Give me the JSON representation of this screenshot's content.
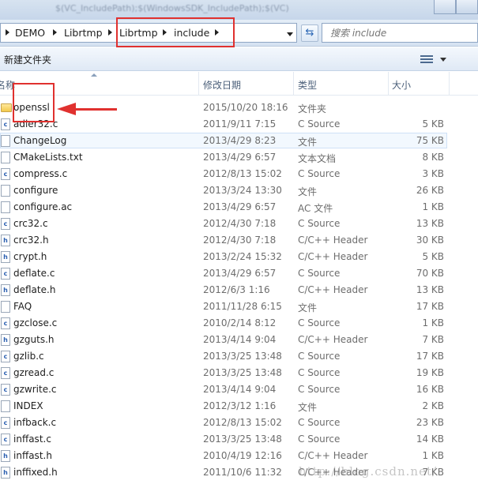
{
  "window_title_blur": "$(VC_IncludePath);$(WindowsSDK_IncludePath);$(VC)",
  "address": {
    "crumbs": [
      "DEMO",
      "Librtmp",
      "Librtmp",
      "include"
    ],
    "search_placeholder": "搜索 include"
  },
  "toolbar": {
    "new_folder": "新建文件夹"
  },
  "columns": {
    "name": "名称",
    "date": "修改日期",
    "type": "类型",
    "size": "大小"
  },
  "files": [
    {
      "name": "openssl",
      "date": "2015/10/20 18:16",
      "type": "文件夹",
      "size": "",
      "icon": "folder-icon"
    },
    {
      "name": "adler32.c",
      "date": "2011/9/11 7:15",
      "type": "C Source",
      "size": "5 KB",
      "icon": "c-source-icon"
    },
    {
      "name": "ChangeLog",
      "date": "2013/4/29 8:23",
      "type": "文件",
      "size": "75 KB",
      "icon": "file-icon"
    },
    {
      "name": "CMakeLists.txt",
      "date": "2013/4/29 6:57",
      "type": "文本文档",
      "size": "8 KB",
      "icon": "text-file-icon"
    },
    {
      "name": "compress.c",
      "date": "2012/8/13 15:02",
      "type": "C Source",
      "size": "3 KB",
      "icon": "c-source-icon"
    },
    {
      "name": "configure",
      "date": "2013/3/24 13:30",
      "type": "文件",
      "size": "26 KB",
      "icon": "file-icon"
    },
    {
      "name": "configure.ac",
      "date": "2013/4/29 6:57",
      "type": "AC 文件",
      "size": "1 KB",
      "icon": "file-icon"
    },
    {
      "name": "crc32.c",
      "date": "2012/4/30 7:18",
      "type": "C Source",
      "size": "13 KB",
      "icon": "c-source-icon"
    },
    {
      "name": "crc32.h",
      "date": "2012/4/30 7:18",
      "type": "C/C++ Header",
      "size": "30 KB",
      "icon": "header-icon"
    },
    {
      "name": "crypt.h",
      "date": "2013/2/24 15:32",
      "type": "C/C++ Header",
      "size": "5 KB",
      "icon": "header-icon"
    },
    {
      "name": "deflate.c",
      "date": "2013/4/29 6:57",
      "type": "C Source",
      "size": "70 KB",
      "icon": "c-source-icon"
    },
    {
      "name": "deflate.h",
      "date": "2012/6/3 1:16",
      "type": "C/C++ Header",
      "size": "13 KB",
      "icon": "header-icon"
    },
    {
      "name": "FAQ",
      "date": "2011/11/28 6:15",
      "type": "文件",
      "size": "17 KB",
      "icon": "file-icon"
    },
    {
      "name": "gzclose.c",
      "date": "2010/2/14 8:12",
      "type": "C Source",
      "size": "1 KB",
      "icon": "c-source-icon"
    },
    {
      "name": "gzguts.h",
      "date": "2013/4/14 9:04",
      "type": "C/C++ Header",
      "size": "7 KB",
      "icon": "header-icon"
    },
    {
      "name": "gzlib.c",
      "date": "2013/3/25 13:48",
      "type": "C Source",
      "size": "17 KB",
      "icon": "c-source-icon"
    },
    {
      "name": "gzread.c",
      "date": "2013/3/25 13:48",
      "type": "C Source",
      "size": "19 KB",
      "icon": "c-source-icon"
    },
    {
      "name": "gzwrite.c",
      "date": "2013/4/14 9:04",
      "type": "C Source",
      "size": "16 KB",
      "icon": "c-source-icon"
    },
    {
      "name": "INDEX",
      "date": "2012/3/12 1:16",
      "type": "文件",
      "size": "2 KB",
      "icon": "file-icon"
    },
    {
      "name": "infback.c",
      "date": "2012/8/13 15:02",
      "type": "C Source",
      "size": "23 KB",
      "icon": "c-source-icon"
    },
    {
      "name": "inffast.c",
      "date": "2013/3/25 13:48",
      "type": "C Source",
      "size": "14 KB",
      "icon": "c-source-icon"
    },
    {
      "name": "inffast.h",
      "date": "2010/4/19 12:16",
      "type": "C/C++ Header",
      "size": "1 KB",
      "icon": "header-icon"
    },
    {
      "name": "inffixed.h",
      "date": "2011/10/6 11:32",
      "type": "C/C++ Header",
      "size": "7 KB",
      "icon": "header-icon"
    }
  ],
  "highlighted_row": 2,
  "watermark": "http://blog.csdn.net/",
  "colors": {
    "annotation": "#e0312f",
    "hover": "#f2f8fe"
  }
}
